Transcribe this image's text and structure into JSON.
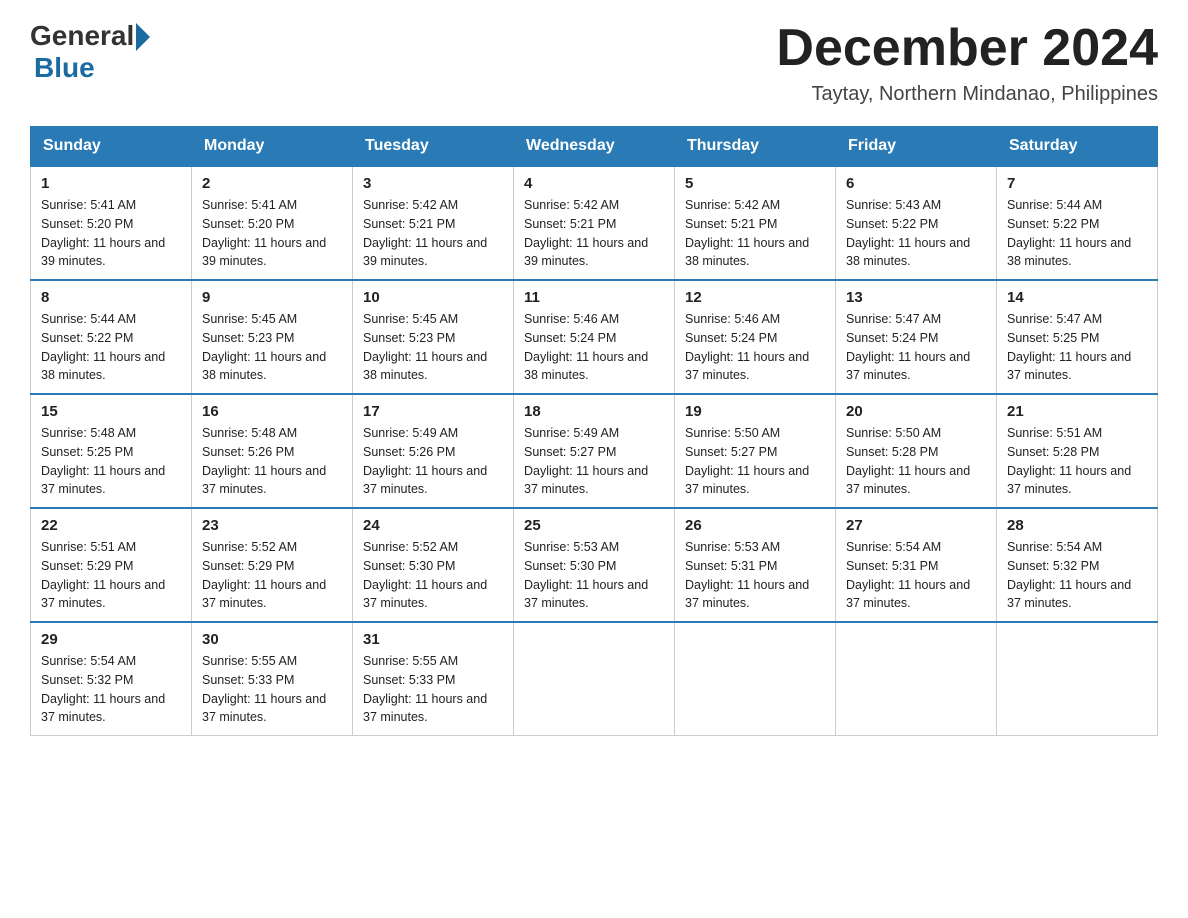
{
  "header": {
    "logo_general": "General",
    "logo_blue": "Blue",
    "month_title": "December 2024",
    "location": "Taytay, Northern Mindanao, Philippines"
  },
  "weekdays": [
    "Sunday",
    "Monday",
    "Tuesday",
    "Wednesday",
    "Thursday",
    "Friday",
    "Saturday"
  ],
  "weeks": [
    [
      {
        "day": "1",
        "sunrise": "5:41 AM",
        "sunset": "5:20 PM",
        "daylight": "11 hours and 39 minutes."
      },
      {
        "day": "2",
        "sunrise": "5:41 AM",
        "sunset": "5:20 PM",
        "daylight": "11 hours and 39 minutes."
      },
      {
        "day": "3",
        "sunrise": "5:42 AM",
        "sunset": "5:21 PM",
        "daylight": "11 hours and 39 minutes."
      },
      {
        "day": "4",
        "sunrise": "5:42 AM",
        "sunset": "5:21 PM",
        "daylight": "11 hours and 39 minutes."
      },
      {
        "day": "5",
        "sunrise": "5:42 AM",
        "sunset": "5:21 PM",
        "daylight": "11 hours and 38 minutes."
      },
      {
        "day": "6",
        "sunrise": "5:43 AM",
        "sunset": "5:22 PM",
        "daylight": "11 hours and 38 minutes."
      },
      {
        "day": "7",
        "sunrise": "5:44 AM",
        "sunset": "5:22 PM",
        "daylight": "11 hours and 38 minutes."
      }
    ],
    [
      {
        "day": "8",
        "sunrise": "5:44 AM",
        "sunset": "5:22 PM",
        "daylight": "11 hours and 38 minutes."
      },
      {
        "day": "9",
        "sunrise": "5:45 AM",
        "sunset": "5:23 PM",
        "daylight": "11 hours and 38 minutes."
      },
      {
        "day": "10",
        "sunrise": "5:45 AM",
        "sunset": "5:23 PM",
        "daylight": "11 hours and 38 minutes."
      },
      {
        "day": "11",
        "sunrise": "5:46 AM",
        "sunset": "5:24 PM",
        "daylight": "11 hours and 38 minutes."
      },
      {
        "day": "12",
        "sunrise": "5:46 AM",
        "sunset": "5:24 PM",
        "daylight": "11 hours and 37 minutes."
      },
      {
        "day": "13",
        "sunrise": "5:47 AM",
        "sunset": "5:24 PM",
        "daylight": "11 hours and 37 minutes."
      },
      {
        "day": "14",
        "sunrise": "5:47 AM",
        "sunset": "5:25 PM",
        "daylight": "11 hours and 37 minutes."
      }
    ],
    [
      {
        "day": "15",
        "sunrise": "5:48 AM",
        "sunset": "5:25 PM",
        "daylight": "11 hours and 37 minutes."
      },
      {
        "day": "16",
        "sunrise": "5:48 AM",
        "sunset": "5:26 PM",
        "daylight": "11 hours and 37 minutes."
      },
      {
        "day": "17",
        "sunrise": "5:49 AM",
        "sunset": "5:26 PM",
        "daylight": "11 hours and 37 minutes."
      },
      {
        "day": "18",
        "sunrise": "5:49 AM",
        "sunset": "5:27 PM",
        "daylight": "11 hours and 37 minutes."
      },
      {
        "day": "19",
        "sunrise": "5:50 AM",
        "sunset": "5:27 PM",
        "daylight": "11 hours and 37 minutes."
      },
      {
        "day": "20",
        "sunrise": "5:50 AM",
        "sunset": "5:28 PM",
        "daylight": "11 hours and 37 minutes."
      },
      {
        "day": "21",
        "sunrise": "5:51 AM",
        "sunset": "5:28 PM",
        "daylight": "11 hours and 37 minutes."
      }
    ],
    [
      {
        "day": "22",
        "sunrise": "5:51 AM",
        "sunset": "5:29 PM",
        "daylight": "11 hours and 37 minutes."
      },
      {
        "day": "23",
        "sunrise": "5:52 AM",
        "sunset": "5:29 PM",
        "daylight": "11 hours and 37 minutes."
      },
      {
        "day": "24",
        "sunrise": "5:52 AM",
        "sunset": "5:30 PM",
        "daylight": "11 hours and 37 minutes."
      },
      {
        "day": "25",
        "sunrise": "5:53 AM",
        "sunset": "5:30 PM",
        "daylight": "11 hours and 37 minutes."
      },
      {
        "day": "26",
        "sunrise": "5:53 AM",
        "sunset": "5:31 PM",
        "daylight": "11 hours and 37 minutes."
      },
      {
        "day": "27",
        "sunrise": "5:54 AM",
        "sunset": "5:31 PM",
        "daylight": "11 hours and 37 minutes."
      },
      {
        "day": "28",
        "sunrise": "5:54 AM",
        "sunset": "5:32 PM",
        "daylight": "11 hours and 37 minutes."
      }
    ],
    [
      {
        "day": "29",
        "sunrise": "5:54 AM",
        "sunset": "5:32 PM",
        "daylight": "11 hours and 37 minutes."
      },
      {
        "day": "30",
        "sunrise": "5:55 AM",
        "sunset": "5:33 PM",
        "daylight": "11 hours and 37 minutes."
      },
      {
        "day": "31",
        "sunrise": "5:55 AM",
        "sunset": "5:33 PM",
        "daylight": "11 hours and 37 minutes."
      },
      null,
      null,
      null,
      null
    ]
  ]
}
